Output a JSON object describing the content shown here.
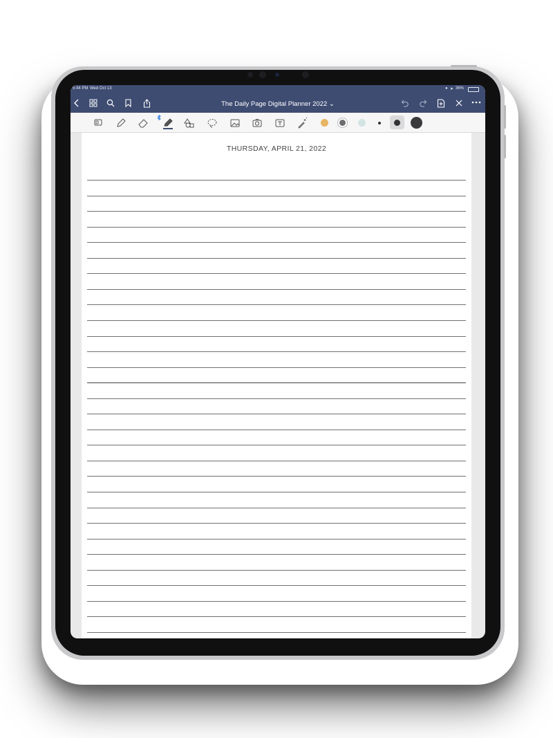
{
  "status_bar": {
    "time": "5:44 PM",
    "date": "Wed Oct 13",
    "battery": "36%"
  },
  "nav": {
    "title": "The Daily Page Digital Planner 2022"
  },
  "toolbar": {
    "tools": [
      "read-mode-icon",
      "pen-icon",
      "eraser-icon",
      "highlighter-icon",
      "shapes-icon",
      "lasso-icon",
      "image-icon",
      "camera-icon",
      "text-icon",
      "laser-pointer-icon"
    ],
    "colors": [
      "#e7b563",
      "#6d6d6f",
      "#d4e4e3"
    ],
    "stroke_sizes": [
      "small",
      "medium",
      "large"
    ]
  },
  "page": {
    "heading": "THURSDAY, APRIL 21, 2022",
    "ruled_line_count": 30
  }
}
